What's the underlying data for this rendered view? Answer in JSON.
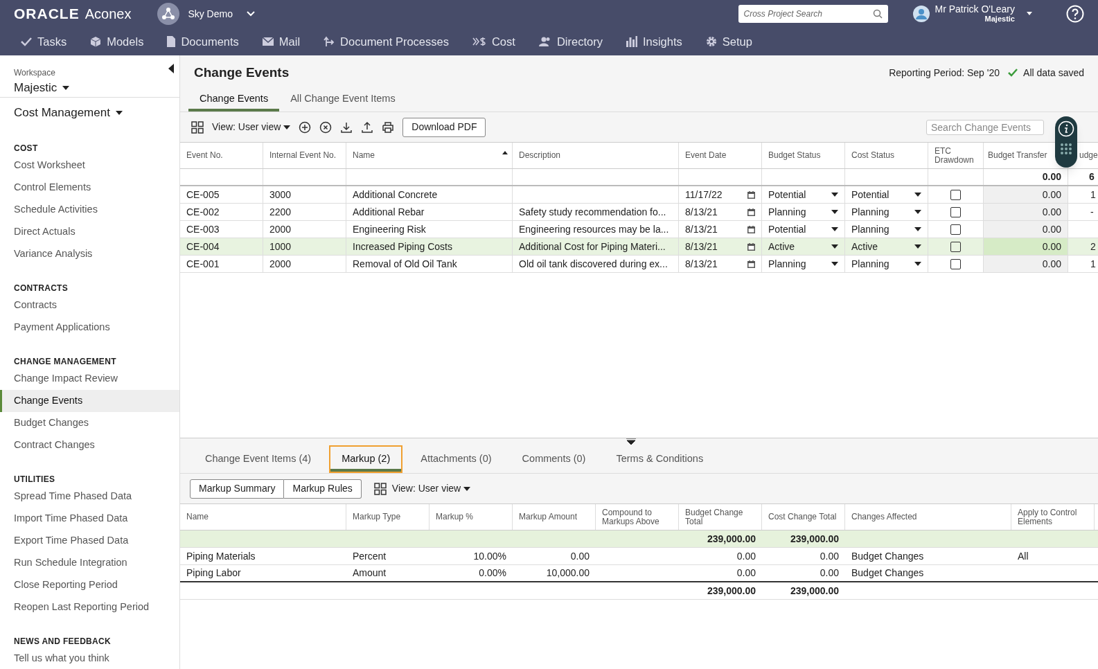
{
  "header": {
    "logo_brand": "ORACLE",
    "logo_product": "Aconex",
    "project": "Sky Demo",
    "search": {
      "placeholder": "Cross Project Search"
    },
    "user_name": "Mr Patrick O'Leary",
    "user_project": "Majestic",
    "nav": [
      {
        "label": "Tasks"
      },
      {
        "label": "Models"
      },
      {
        "label": "Documents"
      },
      {
        "label": "Mail"
      },
      {
        "label": "Document Processes"
      },
      {
        "label": "Cost"
      },
      {
        "label": "Directory"
      },
      {
        "label": "Insights"
      },
      {
        "label": "Setup"
      }
    ]
  },
  "sidebar": {
    "workspace_label": "Workspace",
    "workspace": "Majestic",
    "module": "Cost Management",
    "sections": [
      {
        "heading": "COST",
        "items": [
          {
            "label": "Cost Worksheet",
            "selected": false
          },
          {
            "label": "Control Elements",
            "selected": false
          },
          {
            "label": "Schedule Activities",
            "selected": false
          },
          {
            "label": "Direct Actuals",
            "selected": false
          },
          {
            "label": "Variance Analysis",
            "selected": false
          }
        ]
      },
      {
        "heading": "CONTRACTS",
        "items": [
          {
            "label": "Contracts",
            "selected": false
          },
          {
            "label": "Payment Applications",
            "selected": false
          }
        ]
      },
      {
        "heading": "CHANGE MANAGEMENT",
        "items": [
          {
            "label": "Change Impact Review",
            "selected": false
          },
          {
            "label": "Change Events",
            "selected": true
          },
          {
            "label": "Budget Changes",
            "selected": false
          },
          {
            "label": "Contract Changes",
            "selected": false
          }
        ]
      },
      {
        "heading": "UTILITIES",
        "items": [
          {
            "label": "Spread Time Phased Data",
            "selected": false
          },
          {
            "label": "Import Time Phased Data",
            "selected": false
          },
          {
            "label": "Export Time Phased Data",
            "selected": false
          },
          {
            "label": "Run Schedule Integration",
            "selected": false
          },
          {
            "label": "Close Reporting Period",
            "selected": false
          },
          {
            "label": "Reopen Last Reporting Period",
            "selected": false
          }
        ]
      },
      {
        "heading": "NEWS AND FEEDBACK",
        "items": [
          {
            "label": "Tell us what you think",
            "selected": false
          }
        ]
      }
    ]
  },
  "page": {
    "title": "Change Events",
    "reporting_period": "Reporting Period: Sep '20",
    "save_status": "All data saved",
    "tabs": [
      {
        "label": "Change Events",
        "selected": true
      },
      {
        "label": "All Change Event Items",
        "selected": false
      }
    ],
    "toolbar": {
      "view": "View: User view",
      "download_button": "Download PDF",
      "search": {
        "placeholder": "Search Change Events"
      }
    }
  },
  "events_table": {
    "columns": [
      "Event No.",
      "Internal Event No.",
      "Name",
      "Description",
      "Event Date",
      "Budget Status",
      "Cost Status",
      "ETC Drawdown",
      "Budget Transfer",
      "udge"
    ],
    "totals": {
      "budget_transfer": "0.00",
      "column_10": "6"
    },
    "rows": [
      {
        "event_no": "CE-005",
        "internal_no": "3000",
        "name": "Additional Concrete",
        "date": "11/17/22",
        "budget_status": "Potential",
        "cost_status": "Potential",
        "etc_drawdown": false,
        "budget_transfer": "0.00",
        "column_10": "1",
        "selected": false
      },
      {
        "event_no": "CE-002",
        "internal_no": "2200",
        "name": "Additional Rebar",
        "description": "Safety study recommendation fo...",
        "date": "8/13/21",
        "budget_status": "Planning",
        "cost_status": "Planning",
        "etc_drawdown": false,
        "budget_transfer": "0.00",
        "column_10": "-",
        "selected": false
      },
      {
        "event_no": "CE-003",
        "internal_no": "2000",
        "name": "Engineering Risk",
        "description": "Engineering resources may be la...",
        "date": "8/13/21",
        "budget_status": "Potential",
        "cost_status": "Planning",
        "etc_drawdown": false,
        "budget_transfer": "0.00",
        "selected": false
      },
      {
        "event_no": "CE-004",
        "internal_no": "1000",
        "name": "Increased Piping Costs",
        "description": "Additional Cost for Piping Materi...",
        "date": "8/13/21",
        "budget_status": "Active",
        "cost_status": "Active",
        "etc_drawdown": false,
        "budget_transfer": "0.00",
        "column_10": "2",
        "selected": true
      },
      {
        "event_no": "CE-001",
        "internal_no": "2000",
        "name": "Removal of Old Oil Tank",
        "description": "Old oil tank discovered during ex...",
        "date": "8/13/21",
        "budget_status": "Planning",
        "cost_status": "Planning",
        "etc_drawdown": false,
        "budget_transfer": "0.00",
        "column_10": "1",
        "selected": false
      }
    ]
  },
  "detail_tabs": [
    {
      "label": "Change Event Items (4)",
      "selected": false
    },
    {
      "label": "Markup (2)",
      "selected": true
    },
    {
      "label": "Attachments (0)",
      "selected": false
    },
    {
      "label": "Comments (0)",
      "selected": false
    },
    {
      "label": "Terms & Conditions",
      "selected": false
    }
  ],
  "markup_toolbar": {
    "buttons": [
      "Markup Summary",
      "Markup Rules"
    ],
    "view": "View: User view"
  },
  "markup_table": {
    "columns": [
      "Name",
      "Markup Type",
      "Markup %",
      "Markup Amount",
      "Compound to Markups Above",
      "Budget Change Total",
      "Cost Change Total",
      "Changes Affected",
      "Apply to Control Elements"
    ],
    "top_totals": {
      "budget_change_total": "239,000.00",
      "cost_change_total": "239,000.00"
    },
    "rows": [
      {
        "name": "Piping Materials",
        "markup_type": "Percent",
        "markup_pct": "10.00%",
        "markup_amount": "0.00",
        "budget_change_total": "0.00",
        "cost_change_total": "0.00",
        "changes_affected": "Budget Changes",
        "apply_to_control_elements": "All"
      },
      {
        "name": "Piping Labor",
        "markup_type": "Amount",
        "markup_pct": "0.00%",
        "markup_amount": "10,000.00",
        "budget_change_total": "0.00",
        "cost_change_total": "0.00",
        "changes_affected": "Budget Changes"
      }
    ],
    "bottom_totals": {
      "budget_change_total": "239,000.00",
      "cost_change_total": "239,000.00"
    }
  }
}
